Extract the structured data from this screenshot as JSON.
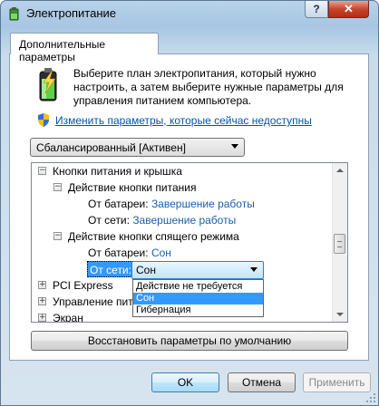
{
  "window": {
    "title": "Электропитание"
  },
  "titlebar": {
    "help_label": "?",
    "close_label": "✕"
  },
  "tab": {
    "label": "Дополнительные параметры"
  },
  "intro": {
    "text": "Выберите план электропитания, который нужно настроить, а затем выберите нужные параметры для управления питанием компьютера."
  },
  "link": {
    "text": "Изменить параметры, которые сейчас недоступны"
  },
  "plan": {
    "selected": "Сбалансированный [Активен]"
  },
  "tree": {
    "power_buttons": "Кнопки питания и крышка",
    "power_button_action": "Действие кнопки питания",
    "on_battery_label": "От батареи:",
    "on_ac_label": "От сети:",
    "power_battery_value": "Завершение работы",
    "power_ac_value": "Завершение работы",
    "sleep_button_action": "Действие кнопки спящего режима",
    "sleep_battery_value": "Сон",
    "sleep_ac_value": "Сон",
    "pci_express": "PCI Express",
    "cpu_power": "Управление пит",
    "screen": "Экран"
  },
  "dropdown": {
    "options": [
      "Действие не требуется",
      "Сон",
      "Гибернация"
    ],
    "selected_index": 1
  },
  "buttons": {
    "restore": "Восстановить параметры по умолчанию",
    "ok": "OK",
    "cancel": "Отмена",
    "apply": "Применить"
  },
  "colors": {
    "link": "#0055b0",
    "value": "#1b5fa8",
    "selection": "#3399ff"
  },
  "icons": [
    "power-battery-icon",
    "uac-shield-icon",
    "expand-icon",
    "collapse-icon"
  ]
}
